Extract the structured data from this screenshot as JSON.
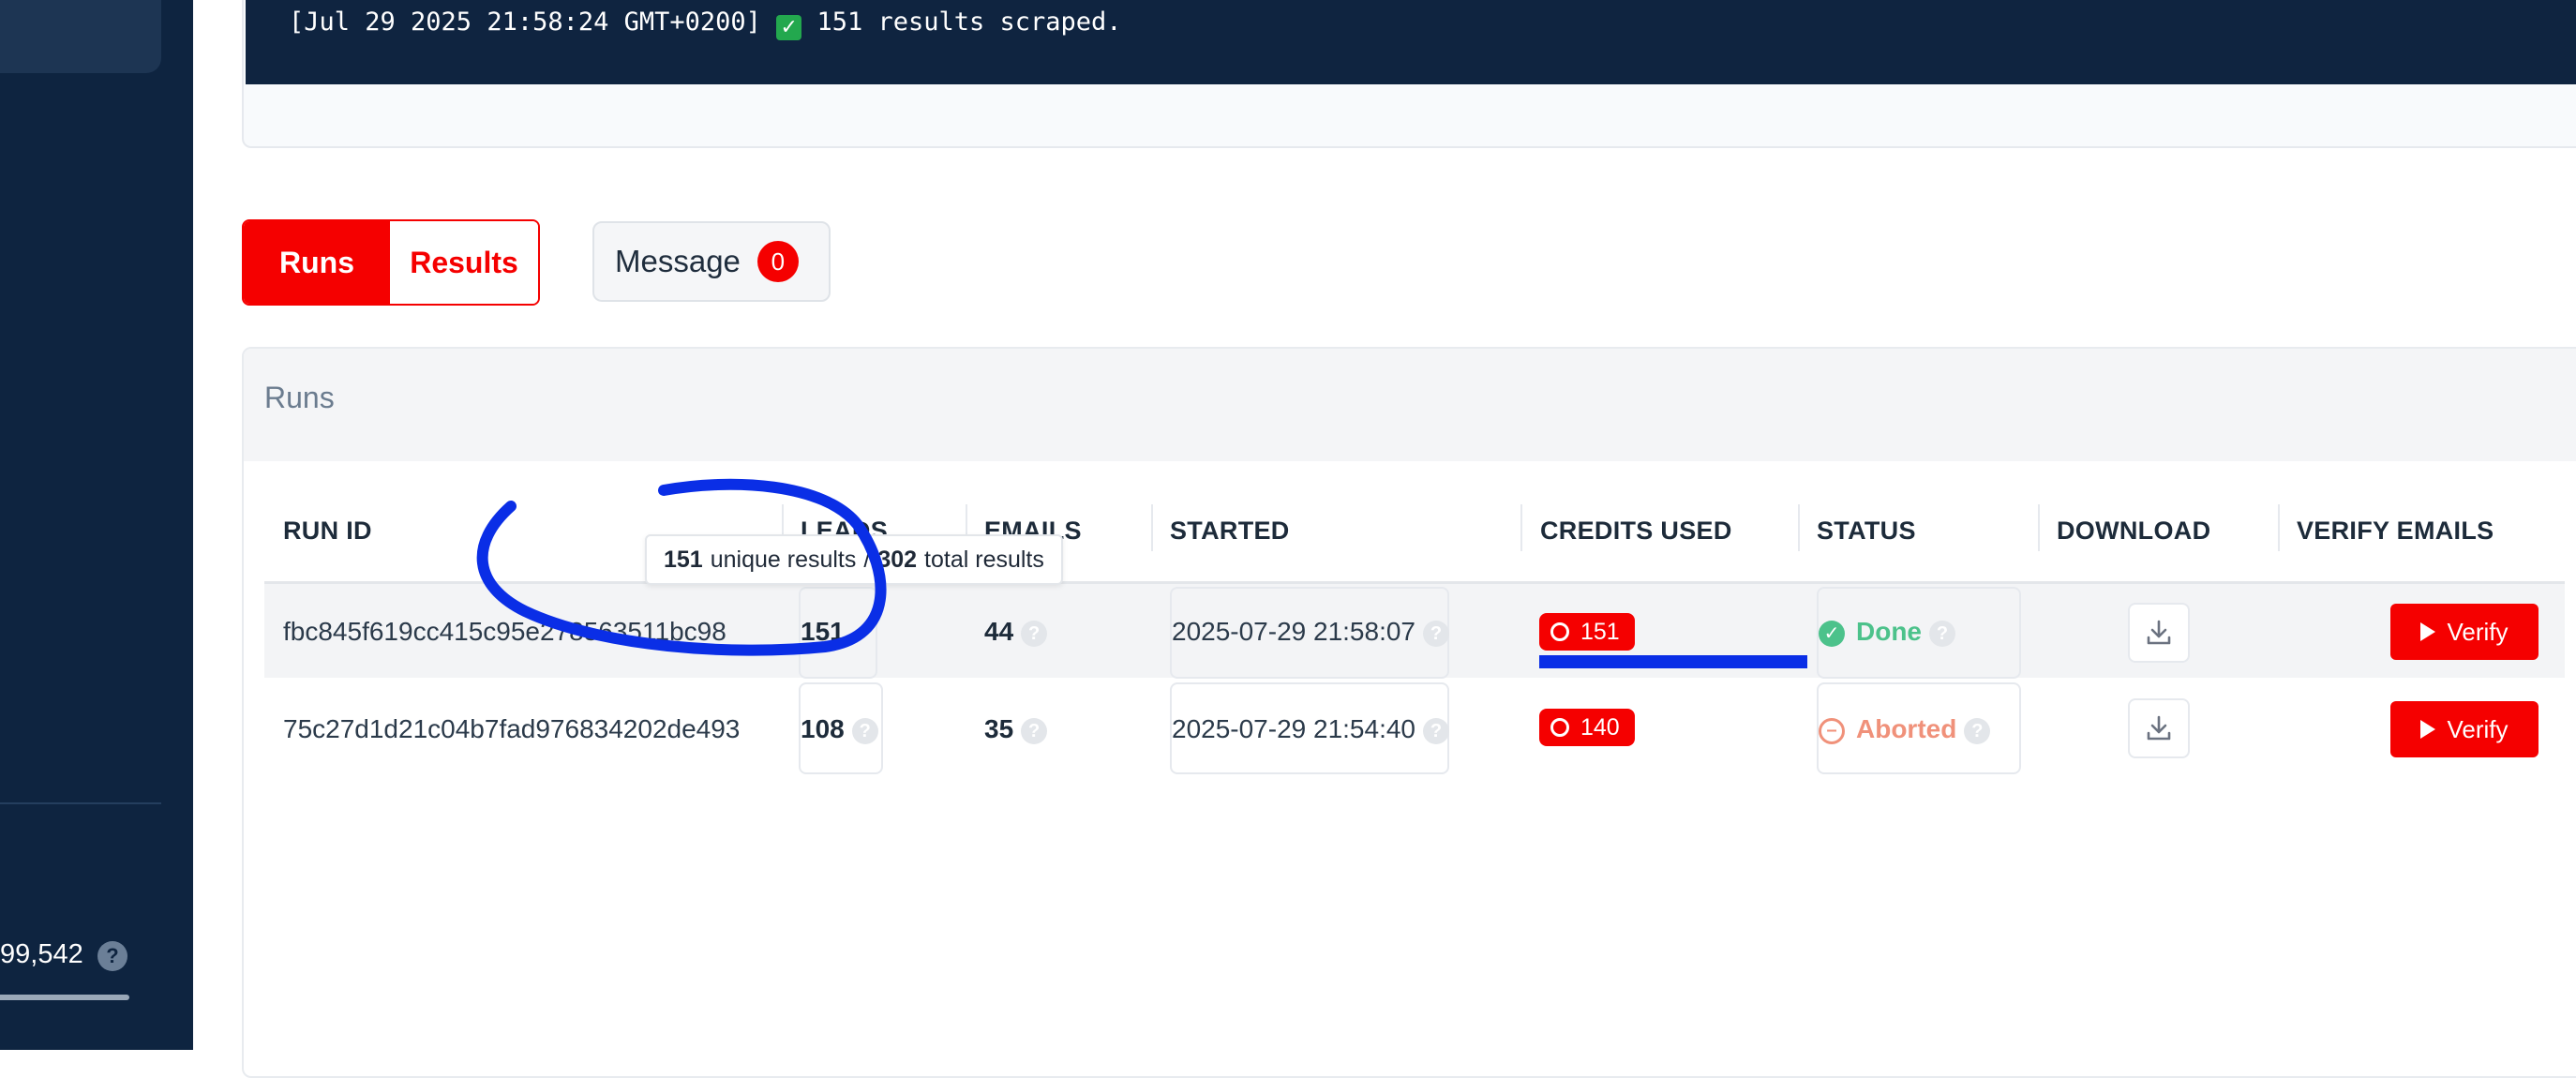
{
  "sidebar": {
    "stat_value": "99,542",
    "help_icon": "question-icon",
    "help_glyph": "?"
  },
  "log": {
    "timestamp": "[Jul 29 2025 21:58:24 GMT+0200]",
    "check_glyph": "✓",
    "message": "151 results scraped."
  },
  "tabs": {
    "runs": "Runs",
    "results": "Results",
    "message_label": "Message",
    "message_count": "0"
  },
  "runs_panel": {
    "title": "Runs"
  },
  "table": {
    "columns": [
      "RUN ID",
      "LEADS",
      "EMAILS",
      "STARTED",
      "CREDITS USED",
      "STATUS",
      "DOWNLOAD",
      "VERIFY EMAILS"
    ],
    "rows": [
      {
        "run_id": "fbc845f619cc415c95e278563511bc98",
        "leads": "151",
        "emails": "44",
        "started": "2025-07-29 21:58:07",
        "credits": "151",
        "status": "Done",
        "verify_label": "Verify"
      },
      {
        "run_id": "75c27d1d21c04b7fad976834202de493",
        "leads": "108",
        "emails": "35",
        "started": "2025-07-29 21:54:40",
        "credits": "140",
        "status": "Aborted",
        "verify_label": "Verify"
      }
    ]
  },
  "tooltip": {
    "unique_count": "151",
    "unique_label": "unique results",
    "separator": "/",
    "total_count": "302",
    "total_label": "total results"
  },
  "colors": {
    "accent": "#f50000",
    "sidebar": "#0e2440",
    "done": "#4cc28b",
    "aborted": "#f0917a",
    "annotation": "#0a2ee6"
  }
}
